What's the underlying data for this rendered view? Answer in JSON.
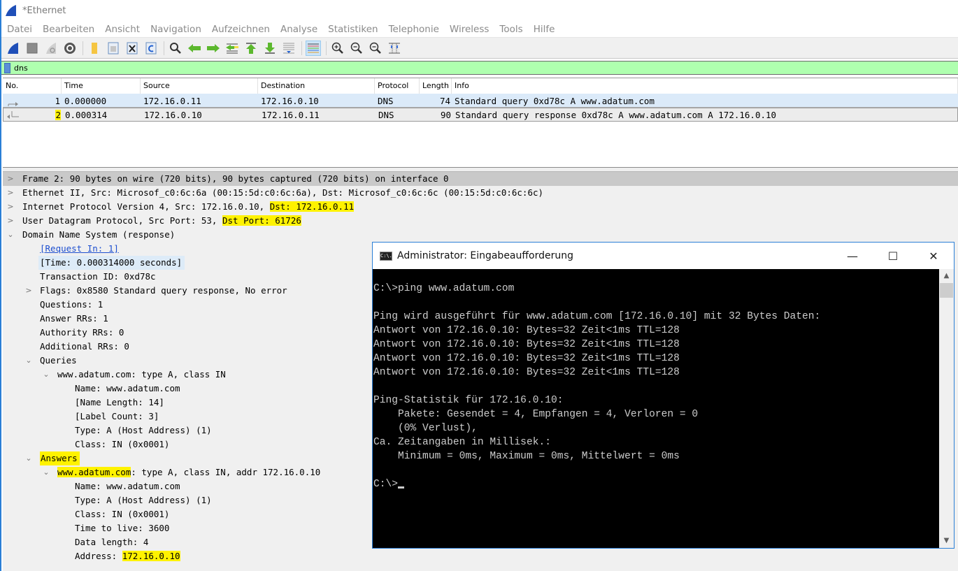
{
  "window": {
    "title": "*Ethernet"
  },
  "menu": [
    "Datei",
    "Bearbeiten",
    "Ansicht",
    "Navigation",
    "Aufzeichnen",
    "Analyse",
    "Statistiken",
    "Telephonie",
    "Wireless",
    "Tools",
    "Hilfe"
  ],
  "toolbar": {
    "icons": [
      "shark-fin-start-icon",
      "stop-icon",
      "restart-icon",
      "capture-options-gear-icon",
      "open-folder-icon",
      "save-file-icon",
      "close-file-icon",
      "reload-file-icon",
      "find-packet-icon",
      "go-back-icon",
      "go-forward-icon",
      "go-to-packet-icon",
      "go-first-icon",
      "go-last-icon",
      "autoscroll-icon",
      "colorize-icon",
      "zoom-in-icon",
      "zoom-out-icon",
      "zoom-normal-icon",
      "resize-columns-icon"
    ]
  },
  "filter": {
    "value": "dns"
  },
  "packet_list": {
    "columns": [
      "No.",
      "Time",
      "Source",
      "Destination",
      "Protocol",
      "Length",
      "Info"
    ],
    "rows": [
      {
        "no": "1",
        "time": "0.000000",
        "source": "172.16.0.11",
        "destination": "172.16.0.10",
        "protocol": "DNS",
        "length": "74",
        "info": "Standard query 0xd78c A www.adatum.com"
      },
      {
        "no": "2",
        "time": "0.000314",
        "source": "172.16.0.10",
        "destination": "172.16.0.11",
        "protocol": "DNS",
        "length": "90",
        "info": "Standard query response 0xd78c A www.adatum.com A 172.16.0.10"
      }
    ]
  },
  "details": {
    "frame": "Frame 2: 90 bytes on wire (720 bits), 90 bytes captured (720 bits) on interface 0",
    "ethernet": "Ethernet II, Src: Microsof_c0:6c:6a (00:15:5d:c0:6c:6a), Dst: Microsof_c0:6c:6c (00:15:5d:c0:6c:6c)",
    "ip_prefix": "Internet Protocol Version 4, Src: 172.16.0.10, ",
    "ip_dst": "Dst: 172.16.0.11",
    "udp_prefix": "User Datagram Protocol, Src Port: 53, ",
    "udp_dst": "Dst Port: 61726",
    "dns": "Domain Name System (response)",
    "request_in": "[Request In: 1]",
    "time": "[Time: 0.000314000 seconds]",
    "transaction_id": "Transaction ID: 0xd78c",
    "flags": "Flags: 0x8580 Standard query response, No error",
    "questions": "Questions: 1",
    "answer_rrs": "Answer RRs: 1",
    "authority_rrs": "Authority RRs: 0",
    "additional_rrs": "Additional RRs: 0",
    "queries": "Queries",
    "query": {
      "header": "www.adatum.com: type A, class IN",
      "name": "Name: www.adatum.com",
      "name_length": "[Name Length: 14]",
      "label_count": "[Label Count: 3]",
      "type": "Type: A (Host Address) (1)",
      "class": "Class: IN (0x0001)"
    },
    "answers": "Answers",
    "answer": {
      "header_name": "www.adatum.com",
      "header_rest": ": type A, class IN, addr 172.16.0.10",
      "name": "Name: www.adatum.com",
      "type": "Type: A (Host Address) (1)",
      "class": "Class: IN (0x0001)",
      "ttl": "Time to live: 3600",
      "data_length": "Data length: 4",
      "address_label": "Address: ",
      "address_value": "172.16.0.10"
    }
  },
  "cmd": {
    "title": "Administrator: Eingabeaufforderung",
    "icon_text": "C:\\.",
    "controls": {
      "minimize": "—",
      "maximize": "☐",
      "close": "✕"
    },
    "lines": [
      "C:\\>ping www.adatum.com",
      "",
      "Ping wird ausgeführt für www.adatum.com [172.16.0.10] mit 32 Bytes Daten:",
      "Antwort von 172.16.0.10: Bytes=32 Zeit<1ms TTL=128",
      "Antwort von 172.16.0.10: Bytes=32 Zeit<1ms TTL=128",
      "Antwort von 172.16.0.10: Bytes=32 Zeit<1ms TTL=128",
      "Antwort von 172.16.0.10: Bytes=32 Zeit<1ms TTL=128",
      "",
      "Ping-Statistik für 172.16.0.10:",
      "    Pakete: Gesendet = 4, Empfangen = 4, Verloren = 0",
      "    (0% Verlust),",
      "Ca. Zeitangaben in Millisek.:",
      "    Minimum = 0ms, Maximum = 0ms, Mittelwert = 0ms",
      ""
    ],
    "prompt": "C:\\>"
  },
  "colors": {
    "filter_ok": "#afffaf",
    "highlight": "#fff200",
    "accent": "#2a7fd6"
  }
}
